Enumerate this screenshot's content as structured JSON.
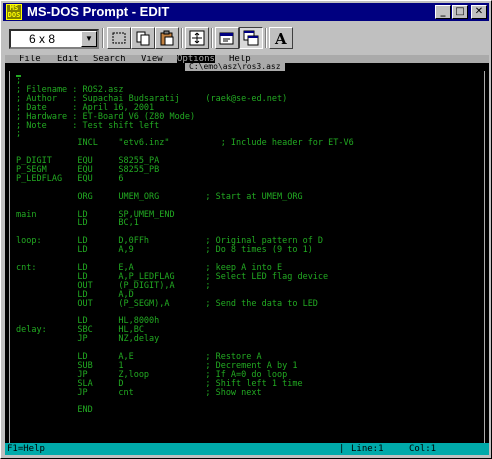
{
  "window": {
    "title": "MS-DOS Prompt - EDIT",
    "icon_text": "MS\nDOS"
  },
  "title_buttons": {
    "minimize": "_",
    "maximize": "□",
    "close": "✕"
  },
  "toolbar": {
    "font_size": "6 x 8"
  },
  "menu": [
    "File",
    "Edit",
    "Search",
    "View",
    "Options",
    "Help"
  ],
  "active_menu": "Options",
  "file_tab": "C:\\emo\\asz\\ros3.asz",
  "editor": {
    "lines": [
      ";",
      "; Filename : ROS2.asz",
      "; Author   : Supachai Budsaratij     (raek@se-ed.net)",
      "; Date     : April 16, 2001",
      "; Hardware : ET-Board V6 (Z80 Mode)",
      "; Note     : Test shift left",
      ";",
      "            INCL    \"etv6.inz\"          ; Include header for ET-V6",
      "",
      "P_DIGIT     EQU     S8255_PA",
      "P_SEGM      EQU     S8255_PB",
      "P_LEDFLAG   EQU     6",
      "",
      "            ORG     UMEM_ORG         ; Start at UMEM_ORG",
      "",
      "main        LD      SP,UMEM_END",
      "            LD      BC,1",
      "",
      "loop:       LD      D,0FFh           ; Original pattern of D",
      "            LD      A,9              ; Do 8 times (9 to 1)",
      "",
      "cnt:        LD      E,A              ; keep A into E",
      "            LD      A,P_LEDFLAG      ; Select LED flag device",
      "            OUT     (P_DIGIT),A      ;",
      "            LD      A,D",
      "            OUT     (P_SEGM),A       ; Send the data to LED",
      "",
      "            LD      HL,8000h",
      "delay:      SBC     HL,BC",
      "            JP      NZ,delay",
      "",
      "            LD      A,E              ; Restore A",
      "            SUB     1                ; Decrement A by 1",
      "            JP      Z,loop           ; If A=0 do loop",
      "            SLA     D                ; Shift left 1 time",
      "            JP      cnt              ; Show next",
      "",
      "            END"
    ]
  },
  "status": {
    "help": "F1=Help",
    "line": "Line:1",
    "col": "Col:1"
  }
}
